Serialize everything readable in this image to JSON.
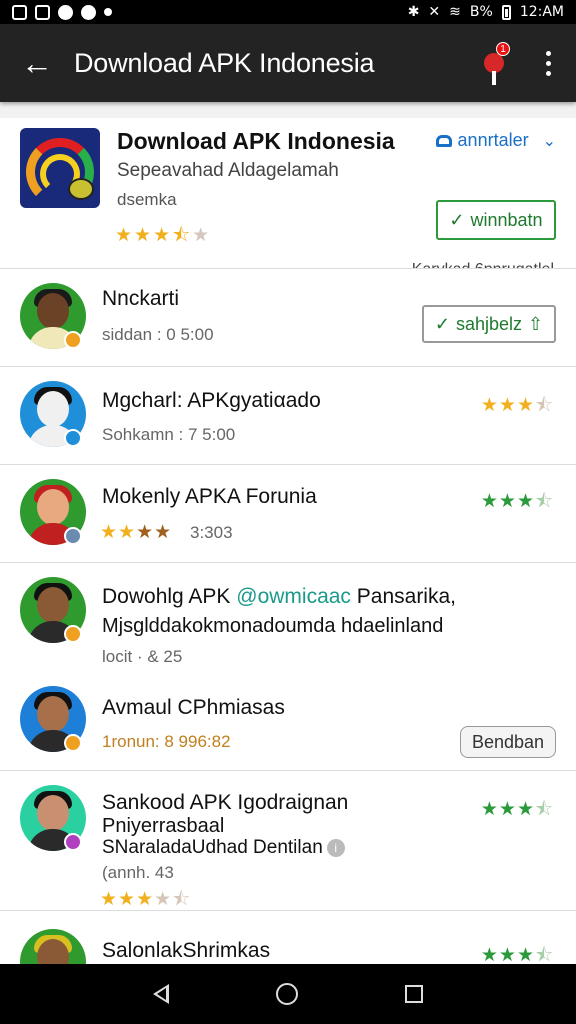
{
  "status_bar": {
    "signal": "B%",
    "time": "12:AM"
  },
  "app_bar": {
    "title": "Download APK Indonesia",
    "notification_badge": "1"
  },
  "featured": {
    "title": "Download APK Indonesia",
    "subtitle": "Sepeavahad Aldagelamah",
    "developer": "dsemka",
    "rating": 3.5,
    "install_link": "annrtaler",
    "install_button": "winnbatn",
    "note": "Karvkad 6pnrugatlel"
  },
  "rows": [
    {
      "title": "Nnckarti",
      "subtitle": "siddan : 0 5:00",
      "button": "sahjbelz"
    },
    {
      "title": "Mgcharl: APKgyatiαado",
      "subtitle": "Sohkamn : 7 5:00",
      "rating": 3.5
    },
    {
      "title": "Mokenly APKA Forunia",
      "subtitle": "3:303",
      "rating": 3.5,
      "inline_rating": 4
    },
    {
      "title_prefix": "Dowohlg APK ",
      "title_link": "@owmicaac",
      "title_suffix": " Pansarika,",
      "line2": "Mjsglddakokmonadoumda hdaelinland",
      "subtitle": "locit · & 25"
    },
    {
      "title": "Avmaul CPhmiasas",
      "subtitle": "1ronun: 8 996:82",
      "button": "Bendban"
    },
    {
      "title": "Sankood APK Igodraignan",
      "line2": "Pniyerrasbaal",
      "line3": "SNaraladaUdhad Dentilan",
      "subtitle": "(annh. 43",
      "rating": 3.5,
      "inline_rating": 3.5
    },
    {
      "title": "SalonlakShrimkas",
      "rating": 3.5
    }
  ],
  "colors": {
    "accent_green": "#2a9a3a",
    "star_gold": "#f2b01e",
    "link_blue": "#1a6fc8",
    "app_bar": "#232323"
  }
}
